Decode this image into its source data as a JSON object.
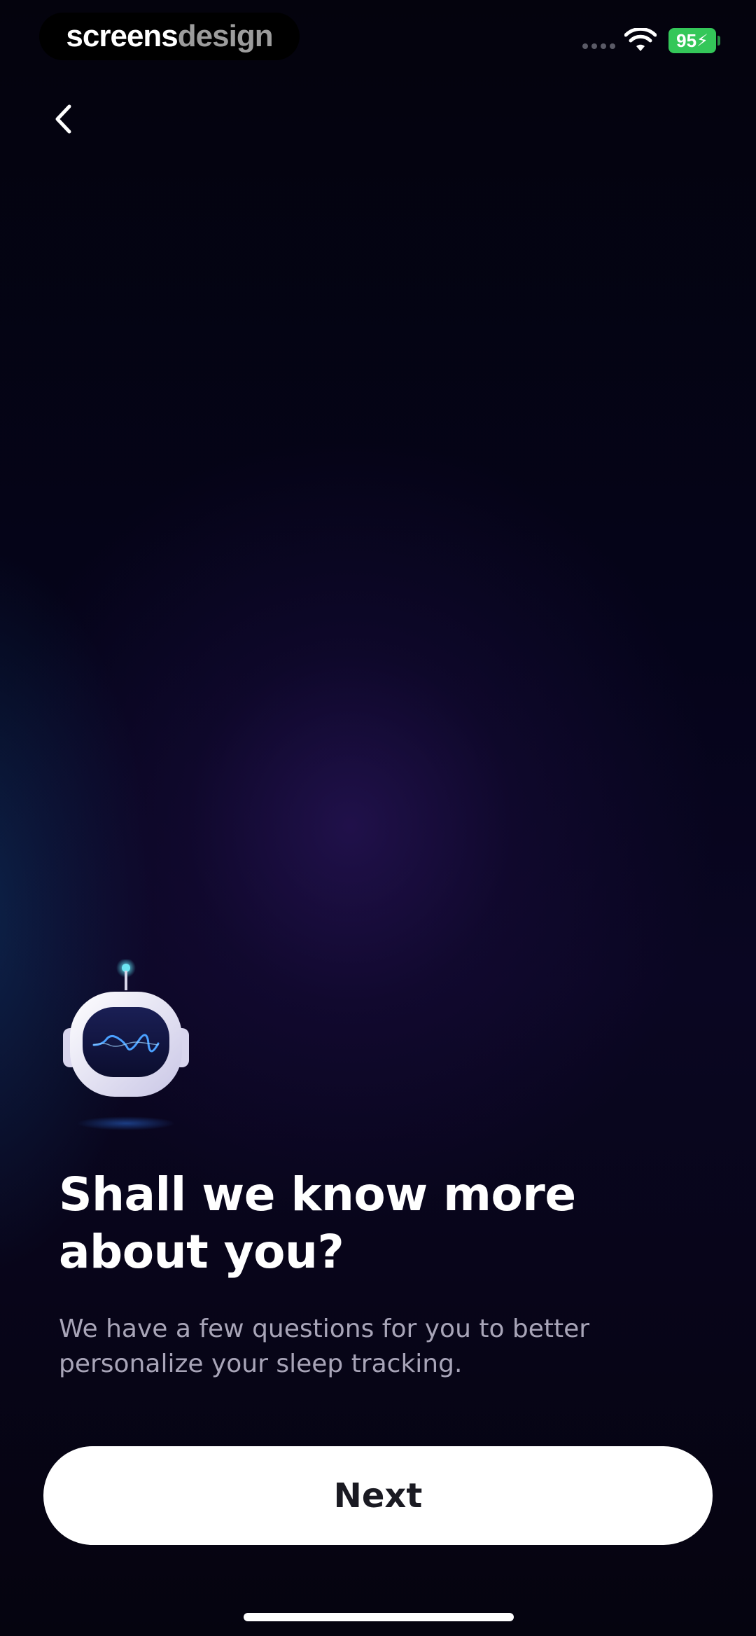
{
  "status_bar": {
    "brand": {
      "primary": "screens",
      "secondary": "design"
    },
    "battery_level": "95",
    "battery_charging": true,
    "wifi_icon": "wifi-icon",
    "signal_icon": "cellular-signal-icon"
  },
  "navigation": {
    "back_icon": "chevron-left-icon"
  },
  "mascot": {
    "icon": "robot-mascot-icon"
  },
  "content": {
    "headline": "Shall we know more about you?",
    "subtext": "We have a few questions for you to better personalize your sleep tracking."
  },
  "actions": {
    "next_label": "Next"
  },
  "colors": {
    "background": "#05040f",
    "glow": "#341a6e",
    "button_bg": "#ffffff",
    "button_text": "#1a1a22",
    "subtext": "#a8a5b8",
    "battery": "#34c759",
    "mascot_accent": "#4fd6e8"
  }
}
